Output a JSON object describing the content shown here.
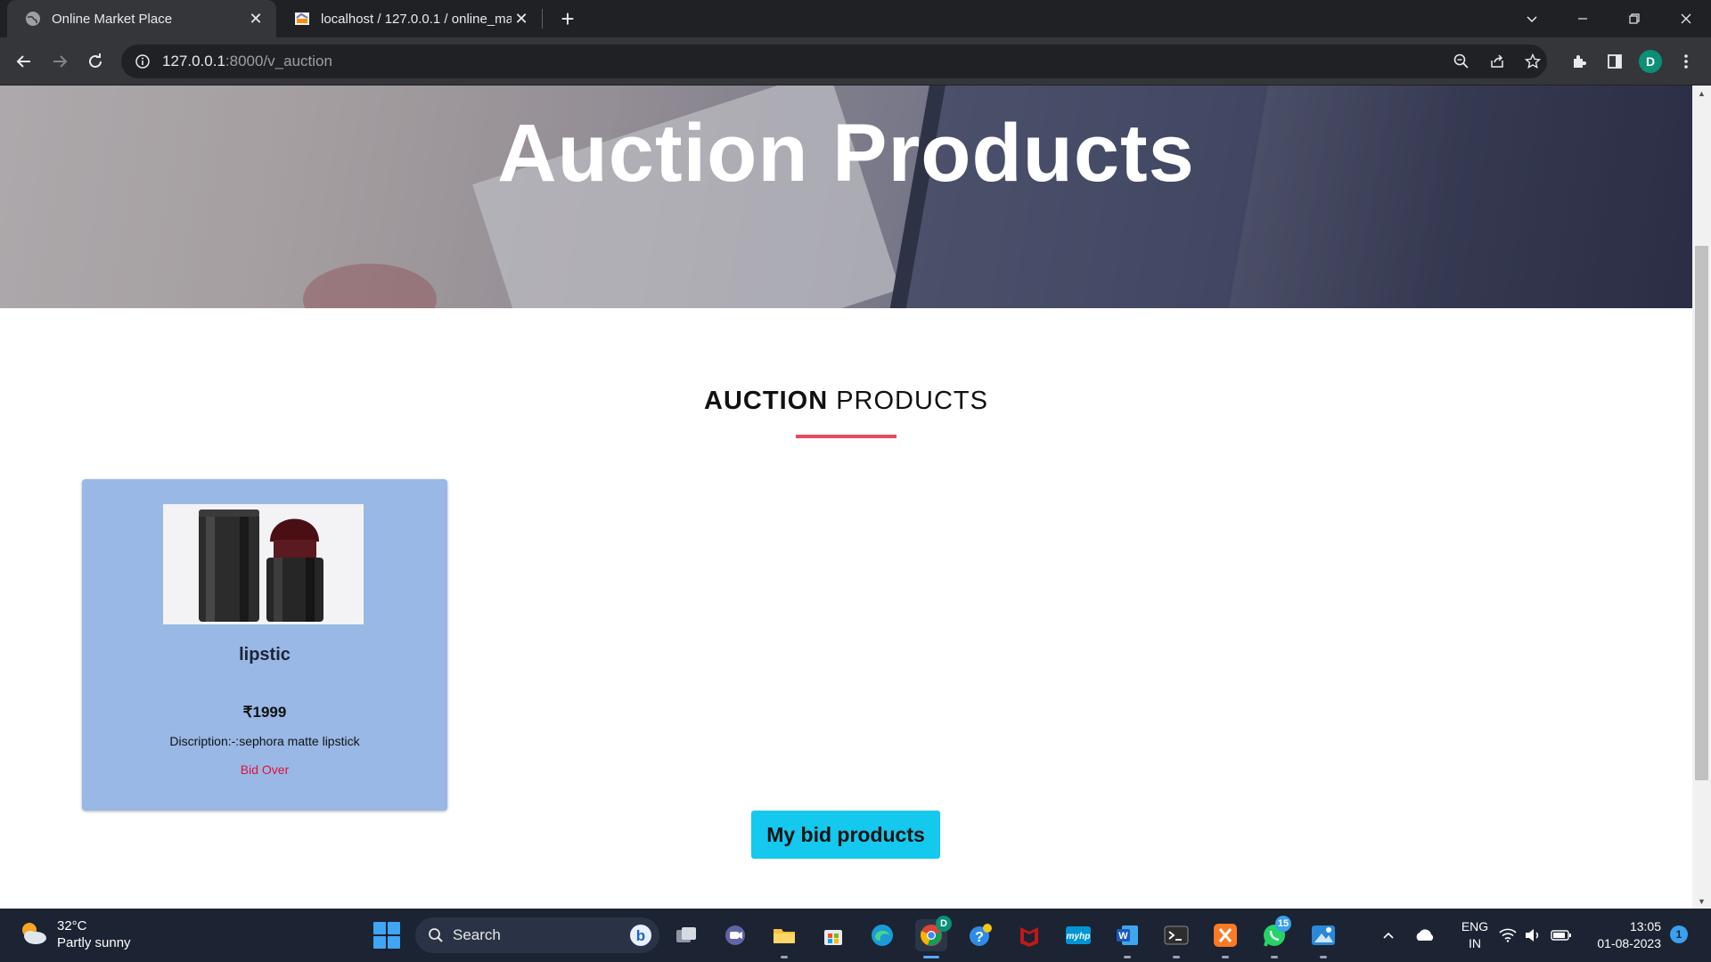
{
  "browser": {
    "tabs": [
      {
        "title": "Online Market Place",
        "icon": "globe-icon",
        "active": true
      },
      {
        "title": "localhost / 127.0.0.1 / online_mar",
        "icon": "phpmyadmin-icon",
        "active": false
      }
    ],
    "address": {
      "host": "127.0.0.1",
      "rest": ":8000/v_auction"
    },
    "profile_initial": "D"
  },
  "page": {
    "hero_title": "Auction Products",
    "section_title_bold": "AUCTION",
    "section_title_rest": " PRODUCTS",
    "products": [
      {
        "name": "lipstic",
        "price": "₹1999",
        "description": "Discription:-:sephora matte lipstick",
        "status": "Bid Over",
        "image": "lipstick-image"
      }
    ],
    "my_bid_button": "My bid products"
  },
  "colors": {
    "card_bg": "#99b8e5",
    "accent_line": "#e84a5f",
    "button_bg": "#14c8ee",
    "status": "#dc143c"
  },
  "taskbar": {
    "weather_temp": "32°C",
    "weather_desc": "Partly sunny",
    "search_label": "Search",
    "whatsapp_badge": "15",
    "chrome_badge": "D",
    "lang_line1": "ENG",
    "lang_line2": "IN",
    "time": "13:05",
    "date": "01-08-2023",
    "notifications": "1"
  }
}
